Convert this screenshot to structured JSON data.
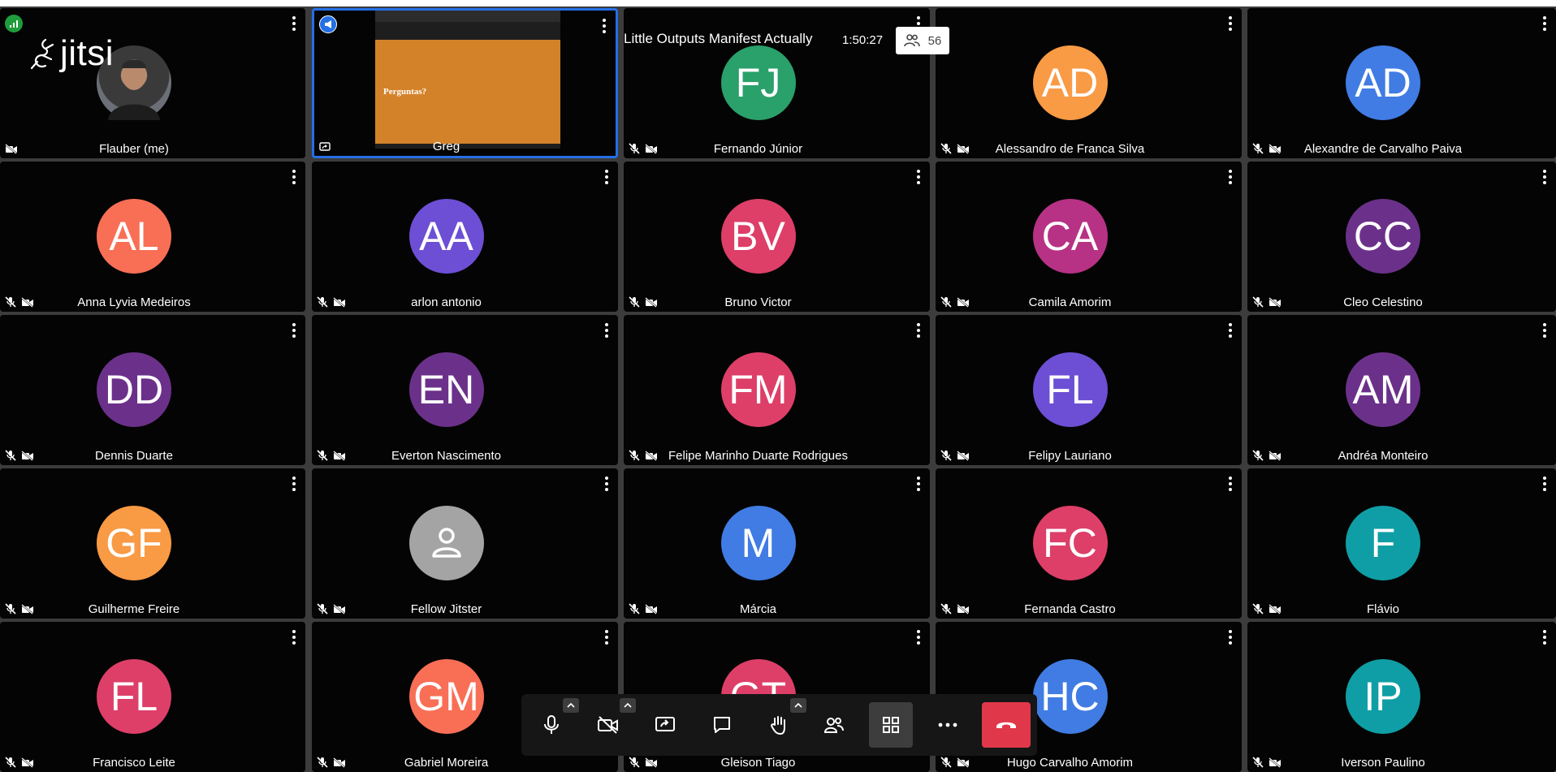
{
  "meeting": {
    "title": "Little Outputs Manifest Actually",
    "timer": "1:50:27",
    "participant_count": "56",
    "logo_text": "jitsi"
  },
  "screen_share": {
    "slide_text": "Perguntas?",
    "slide_color": "#d4822a"
  },
  "participants": [
    {
      "name": "Flauber (me)",
      "initials": "",
      "color": "#000000",
      "kind": "photo"
    },
    {
      "name": "Greg",
      "initials": "",
      "color": "#000000",
      "kind": "screenshare"
    },
    {
      "name": "Fernando Júnior",
      "initials": "FJ",
      "color": "#2aa06b",
      "kind": "avatar"
    },
    {
      "name": "Alessandro de Franca Silva",
      "initials": "AD",
      "color": "#f99a45",
      "kind": "avatar"
    },
    {
      "name": "Alexandre de Carvalho Paiva",
      "initials": "AD",
      "color": "#407ce3",
      "kind": "avatar"
    },
    {
      "name": "Anna Lyvia Medeiros",
      "initials": "AL",
      "color": "#f86f56",
      "kind": "avatar"
    },
    {
      "name": "arlon antonio",
      "initials": "AA",
      "color": "#6c4fd4",
      "kind": "avatar"
    },
    {
      "name": "Bruno Victor",
      "initials": "BV",
      "color": "#dd3f68",
      "kind": "avatar"
    },
    {
      "name": "Camila Amorim",
      "initials": "CA",
      "color": "#b73285",
      "kind": "avatar"
    },
    {
      "name": "Cleo Celestino",
      "initials": "CC",
      "color": "#6b318a",
      "kind": "avatar"
    },
    {
      "name": "Dennis Duarte",
      "initials": "DD",
      "color": "#6b318a",
      "kind": "avatar"
    },
    {
      "name": "Everton Nascimento",
      "initials": "EN",
      "color": "#6b318a",
      "kind": "avatar"
    },
    {
      "name": "Felipe Marinho Duarte Rodrigues",
      "initials": "FM",
      "color": "#dd3f68",
      "kind": "avatar"
    },
    {
      "name": "Felipy Lauriano",
      "initials": "FL",
      "color": "#6c4fd4",
      "kind": "avatar"
    },
    {
      "name": "Andréa Monteiro",
      "initials": "AM",
      "color": "#6b318a",
      "kind": "avatar"
    },
    {
      "name": "Guilherme Freire",
      "initials": "GF",
      "color": "#f99a45",
      "kind": "avatar"
    },
    {
      "name": "Fellow Jitster",
      "initials": "",
      "color": "#a4a4a4",
      "kind": "default"
    },
    {
      "name": "Márcia",
      "initials": "M",
      "color": "#407ce3",
      "kind": "avatar"
    },
    {
      "name": "Fernanda Castro",
      "initials": "FC",
      "color": "#dd3f68",
      "kind": "avatar"
    },
    {
      "name": "Flávio",
      "initials": "F",
      "color": "#0f9ea5",
      "kind": "avatar"
    },
    {
      "name": "Francisco Leite",
      "initials": "FL",
      "color": "#dd3f68",
      "kind": "avatar"
    },
    {
      "name": "Gabriel Moreira",
      "initials": "GM",
      "color": "#f86f56",
      "kind": "avatar"
    },
    {
      "name": "Gleison Tiago",
      "initials": "GT",
      "color": "#dd3f68",
      "kind": "avatar"
    },
    {
      "name": "Hugo Carvalho Amorim",
      "initials": "HC",
      "color": "#407ce3",
      "kind": "avatar"
    },
    {
      "name": "Iverson Paulino",
      "initials": "IP",
      "color": "#0f9ea5",
      "kind": "avatar"
    }
  ],
  "toolbar": {
    "buttons": [
      "microphone-icon",
      "camera-off-icon",
      "share-screen-icon",
      "chat-icon",
      "raise-hand-icon",
      "participants-icon",
      "tile-view-icon",
      "more-icon",
      "hangup-icon"
    ],
    "hangup_color": "#e0384a"
  },
  "colors": {
    "active_border": "#246fe5",
    "tile_bg": "#040404",
    "grid_bg": "#3c3c3c"
  }
}
